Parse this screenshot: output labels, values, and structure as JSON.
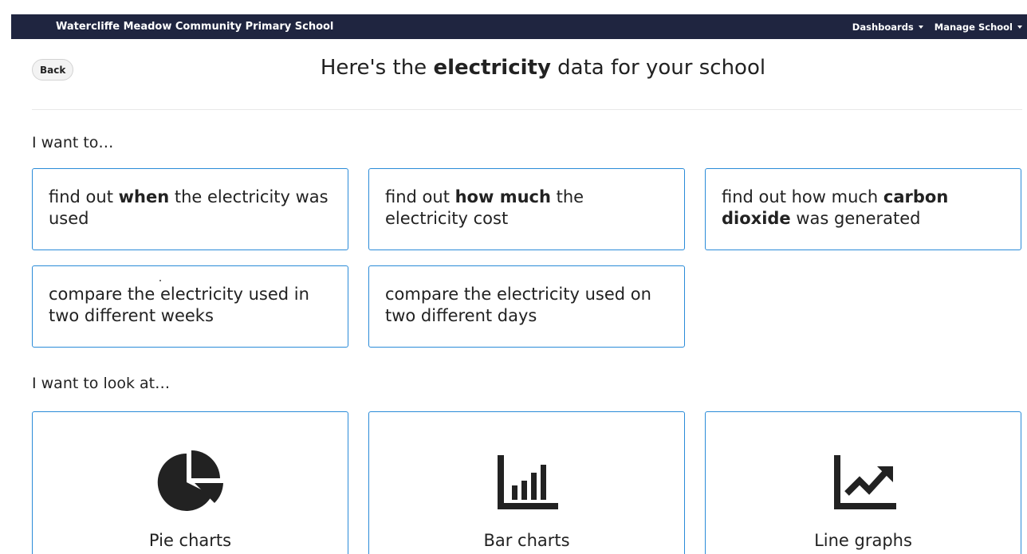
{
  "navbar": {
    "brand": "Watercliffe Meadow Community Primary School",
    "menus": [
      "Dashboards",
      "Manage School"
    ]
  },
  "header": {
    "back_label": "Back",
    "title_prefix": "Here's the ",
    "title_bold": "electricity",
    "title_suffix": " data for your school"
  },
  "sections": {
    "tasks_label": "I want to…",
    "charts_label": "I want to look at…"
  },
  "tasks": [
    {
      "pre": "find out ",
      "bold": "when",
      "post": " the electricity was used"
    },
    {
      "pre": "find out ",
      "bold": "how much",
      "post": " the electricity cost"
    },
    {
      "pre": "find out how much ",
      "bold": "carbon dioxide",
      "post": " was generated"
    },
    {
      "pre": "compare the electricity used in two different weeks",
      "bold": "",
      "post": ""
    },
    {
      "pre": "compare the electricity used on two different days",
      "bold": "",
      "post": ""
    }
  ],
  "charts": [
    {
      "label": "Pie charts",
      "icon": "pie-chart-icon"
    },
    {
      "label": "Bar charts",
      "icon": "bar-chart-icon"
    },
    {
      "label": "Line graphs",
      "icon": "line-chart-icon"
    }
  ],
  "colors": {
    "navbar_bg": "#1f2540",
    "card_border": "#2a8bd8",
    "icon": "#222222"
  }
}
